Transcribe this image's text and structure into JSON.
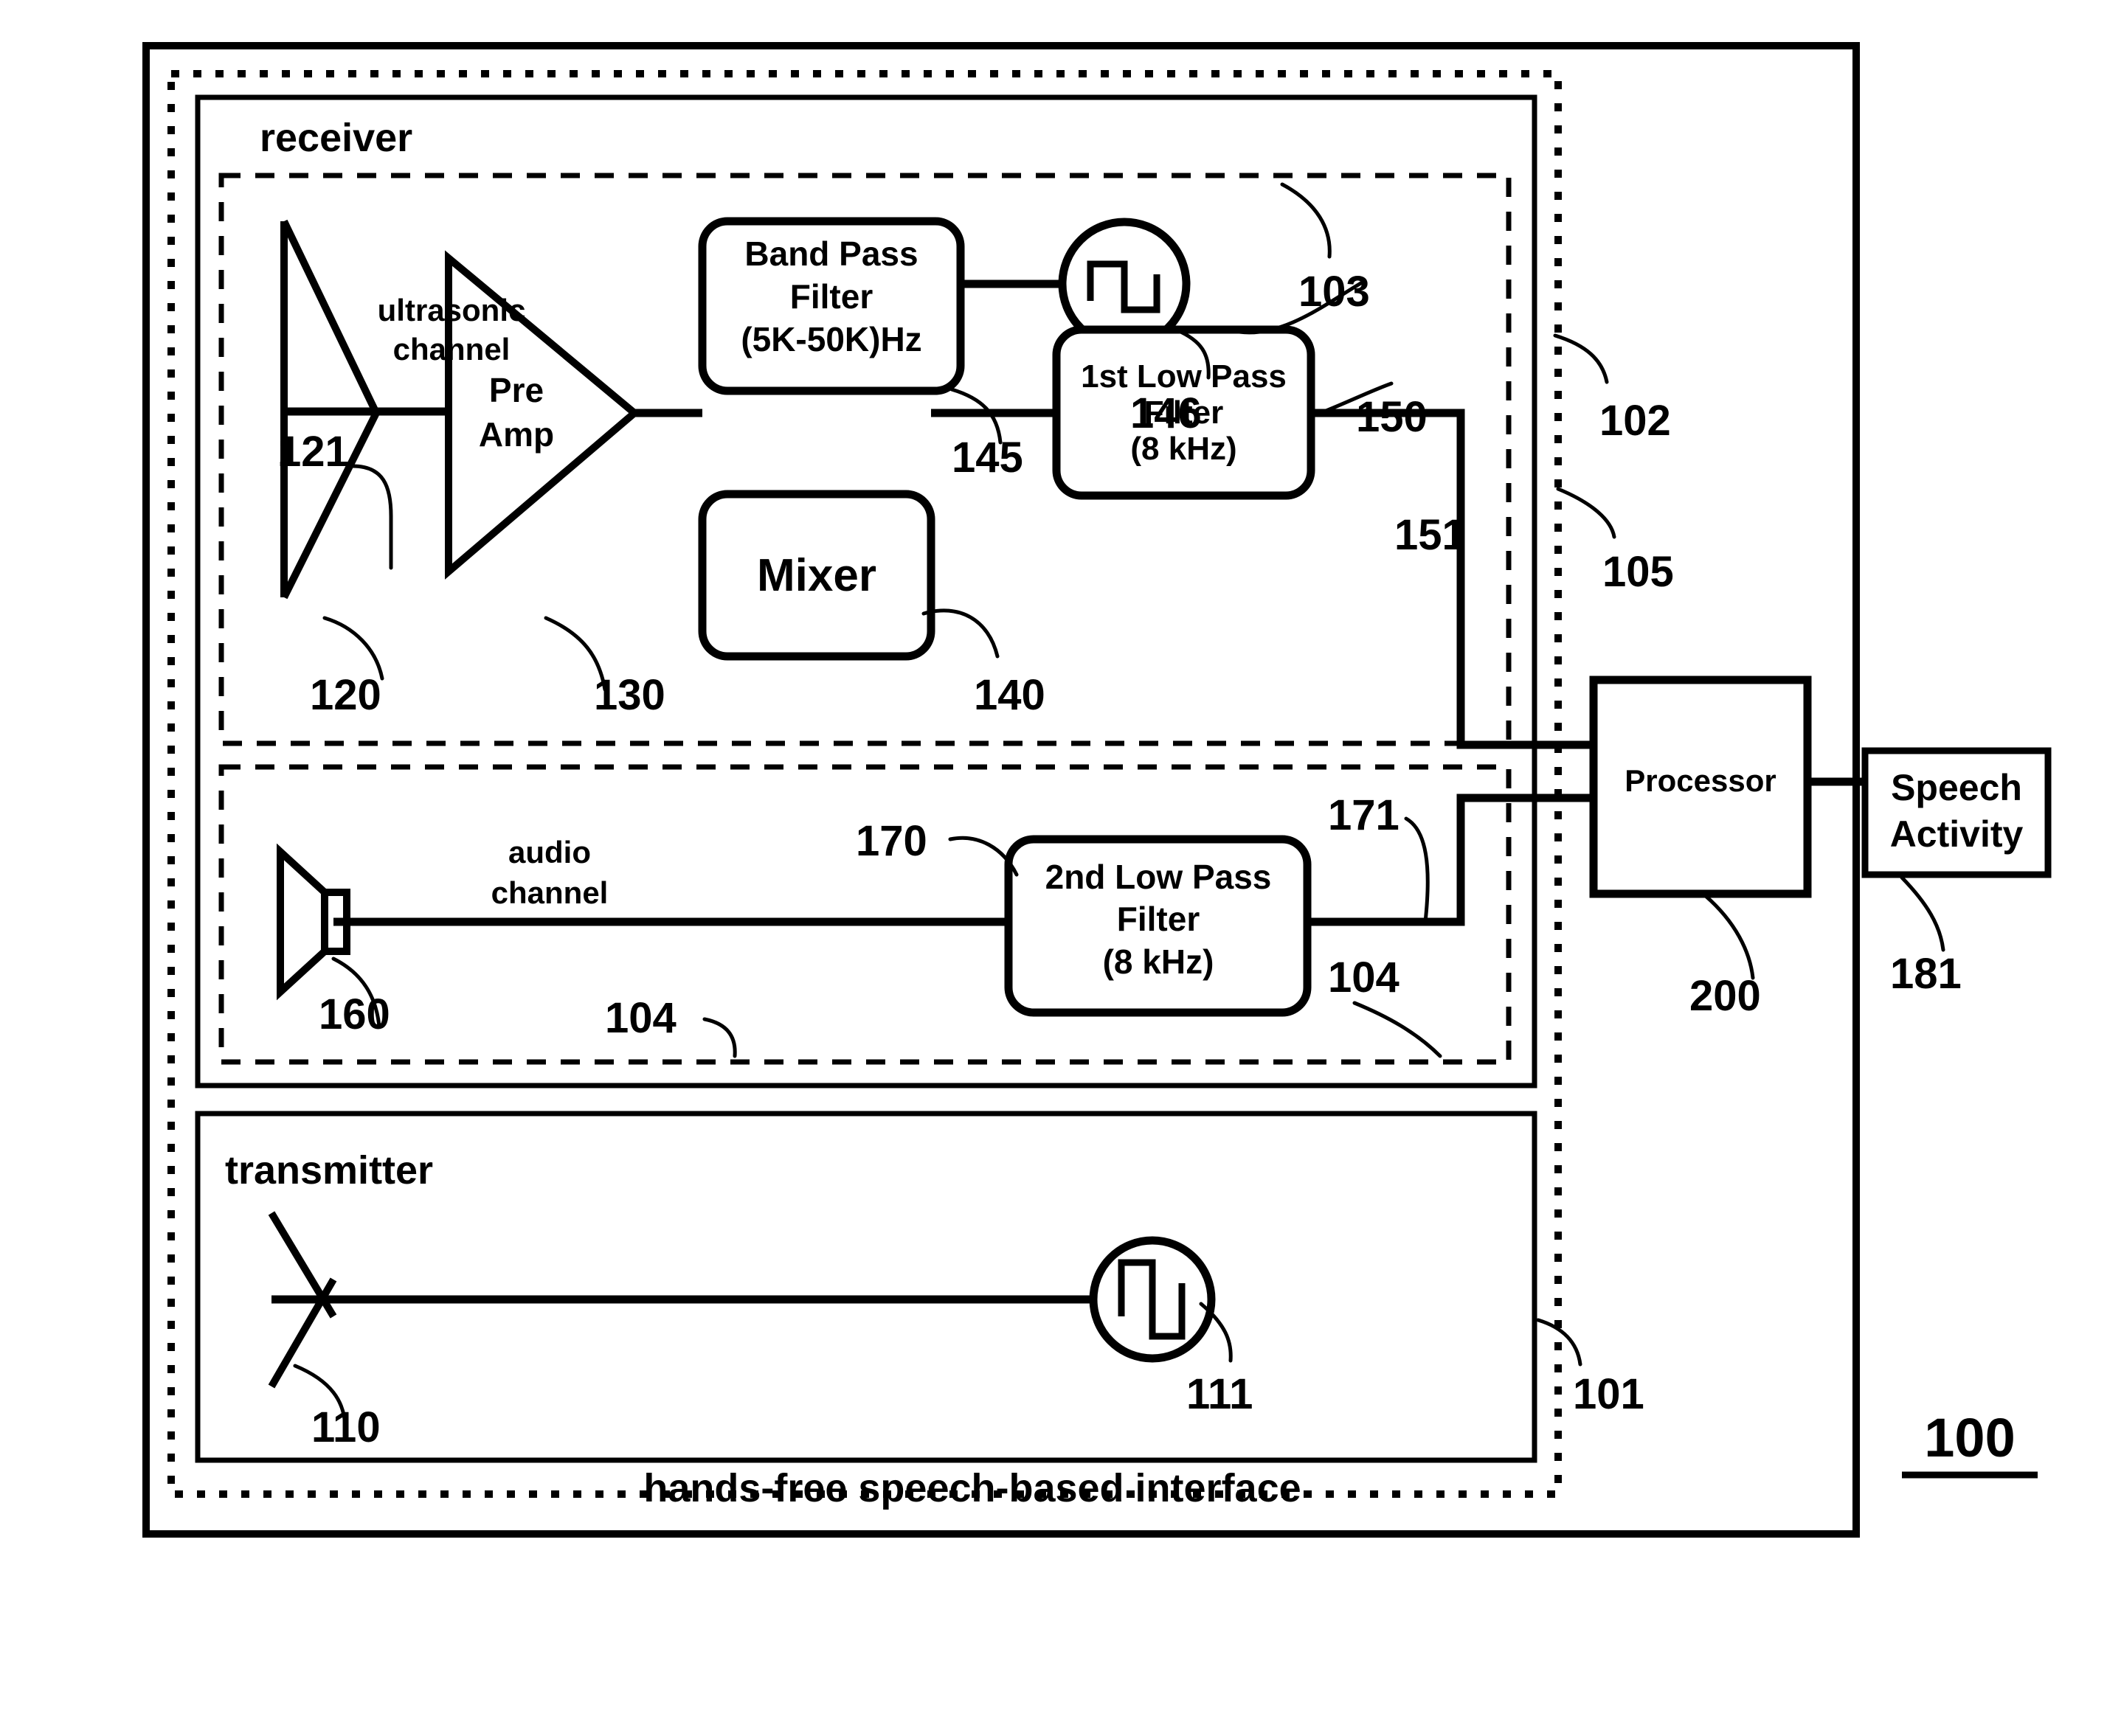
{
  "figure": {
    "number": "100",
    "caption": "hands-free speech-based interface"
  },
  "sections": {
    "receiver": "receiver",
    "transmitter": "transmitter",
    "ultrasonic_channel": "ultrasonic\nchannel",
    "ultrasonic_channel_line1": "ultrasonic",
    "ultrasonic_channel_line2": "channel",
    "audio_channel_line1": "audio",
    "audio_channel_line2": "channel"
  },
  "blocks": {
    "band_pass_filter": {
      "line1": "Band Pass",
      "line2": "Filter",
      "line3": "(5K-50K)Hz",
      "ref": "145"
    },
    "oscillator_rx": {
      "icon": "square-wave-oscillator-icon",
      "ref": "146"
    },
    "pre_amp": {
      "line1": "Pre",
      "line2": "Amp",
      "ref": "130"
    },
    "mixer": {
      "label": "Mixer",
      "ref": "140"
    },
    "first_low_pass_filter": {
      "line1": "1st Low Pass",
      "line2": "Filter",
      "line3": "(8 kHz)",
      "ref": "150"
    },
    "second_low_pass_filter": {
      "line1": "2nd Low Pass",
      "line2": "Filter",
      "line3": "(8 kHz)",
      "ref": "170"
    },
    "processor": {
      "label": "Processor",
      "ref": "200"
    },
    "speech_activity": {
      "line1": "Speech",
      "line2": "Activity",
      "ref": "181"
    },
    "ultrasonic_microphone": {
      "icon": "microphone-icon",
      "ref": "120"
    },
    "audio_microphone": {
      "icon": "microphone-icon",
      "ref": "160"
    },
    "transmitter_speaker": {
      "icon": "speaker-icon",
      "ref": "110"
    },
    "oscillator_tx": {
      "icon": "square-wave-oscillator-icon",
      "ref": "111"
    }
  },
  "refs": {
    "r100": "100",
    "r101": "101",
    "r102": "102",
    "r103": "103",
    "r104_left": "104",
    "r104_right": "104",
    "r105": "105",
    "r110": "110",
    "r111": "111",
    "r120": "120",
    "r121": "121",
    "r130": "130",
    "r140": "140",
    "r145": "145",
    "r146": "146",
    "r150": "150",
    "r151": "151",
    "r160": "160",
    "r170": "170",
    "r171": "171",
    "r181": "181",
    "r200": "200"
  },
  "colors": {
    "ink": "#000000",
    "paper": "#ffffff"
  }
}
